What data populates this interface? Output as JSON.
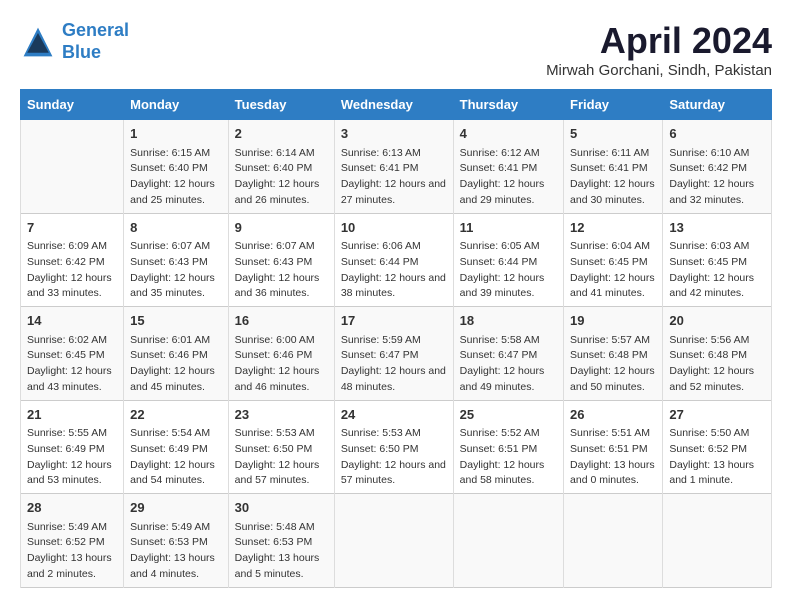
{
  "logo": {
    "line1": "General",
    "line2": "Blue"
  },
  "title": "April 2024",
  "subtitle": "Mirwah Gorchani, Sindh, Pakistan",
  "days_of_week": [
    "Sunday",
    "Monday",
    "Tuesday",
    "Wednesday",
    "Thursday",
    "Friday",
    "Saturday"
  ],
  "weeks": [
    [
      {
        "day": "",
        "info": ""
      },
      {
        "day": "1",
        "info": "Sunrise: 6:15 AM\nSunset: 6:40 PM\nDaylight: 12 hours and 25 minutes."
      },
      {
        "day": "2",
        "info": "Sunrise: 6:14 AM\nSunset: 6:40 PM\nDaylight: 12 hours and 26 minutes."
      },
      {
        "day": "3",
        "info": "Sunrise: 6:13 AM\nSunset: 6:41 PM\nDaylight: 12 hours and 27 minutes."
      },
      {
        "day": "4",
        "info": "Sunrise: 6:12 AM\nSunset: 6:41 PM\nDaylight: 12 hours and 29 minutes."
      },
      {
        "day": "5",
        "info": "Sunrise: 6:11 AM\nSunset: 6:41 PM\nDaylight: 12 hours and 30 minutes."
      },
      {
        "day": "6",
        "info": "Sunrise: 6:10 AM\nSunset: 6:42 PM\nDaylight: 12 hours and 32 minutes."
      }
    ],
    [
      {
        "day": "7",
        "info": "Sunrise: 6:09 AM\nSunset: 6:42 PM\nDaylight: 12 hours and 33 minutes."
      },
      {
        "day": "8",
        "info": "Sunrise: 6:07 AM\nSunset: 6:43 PM\nDaylight: 12 hours and 35 minutes."
      },
      {
        "day": "9",
        "info": "Sunrise: 6:07 AM\nSunset: 6:43 PM\nDaylight: 12 hours and 36 minutes."
      },
      {
        "day": "10",
        "info": "Sunrise: 6:06 AM\nSunset: 6:44 PM\nDaylight: 12 hours and 38 minutes."
      },
      {
        "day": "11",
        "info": "Sunrise: 6:05 AM\nSunset: 6:44 PM\nDaylight: 12 hours and 39 minutes."
      },
      {
        "day": "12",
        "info": "Sunrise: 6:04 AM\nSunset: 6:45 PM\nDaylight: 12 hours and 41 minutes."
      },
      {
        "day": "13",
        "info": "Sunrise: 6:03 AM\nSunset: 6:45 PM\nDaylight: 12 hours and 42 minutes."
      }
    ],
    [
      {
        "day": "14",
        "info": "Sunrise: 6:02 AM\nSunset: 6:45 PM\nDaylight: 12 hours and 43 minutes."
      },
      {
        "day": "15",
        "info": "Sunrise: 6:01 AM\nSunset: 6:46 PM\nDaylight: 12 hours and 45 minutes."
      },
      {
        "day": "16",
        "info": "Sunrise: 6:00 AM\nSunset: 6:46 PM\nDaylight: 12 hours and 46 minutes."
      },
      {
        "day": "17",
        "info": "Sunrise: 5:59 AM\nSunset: 6:47 PM\nDaylight: 12 hours and 48 minutes."
      },
      {
        "day": "18",
        "info": "Sunrise: 5:58 AM\nSunset: 6:47 PM\nDaylight: 12 hours and 49 minutes."
      },
      {
        "day": "19",
        "info": "Sunrise: 5:57 AM\nSunset: 6:48 PM\nDaylight: 12 hours and 50 minutes."
      },
      {
        "day": "20",
        "info": "Sunrise: 5:56 AM\nSunset: 6:48 PM\nDaylight: 12 hours and 52 minutes."
      }
    ],
    [
      {
        "day": "21",
        "info": "Sunrise: 5:55 AM\nSunset: 6:49 PM\nDaylight: 12 hours and 53 minutes."
      },
      {
        "day": "22",
        "info": "Sunrise: 5:54 AM\nSunset: 6:49 PM\nDaylight: 12 hours and 54 minutes."
      },
      {
        "day": "23",
        "info": "Sunrise: 5:53 AM\nSunset: 6:50 PM\nDaylight: 12 hours and 57 minutes."
      },
      {
        "day": "24",
        "info": "Sunrise: 5:53 AM\nSunset: 6:50 PM\nDaylight: 12 hours and 57 minutes."
      },
      {
        "day": "25",
        "info": "Sunrise: 5:52 AM\nSunset: 6:51 PM\nDaylight: 12 hours and 58 minutes."
      },
      {
        "day": "26",
        "info": "Sunrise: 5:51 AM\nSunset: 6:51 PM\nDaylight: 13 hours and 0 minutes."
      },
      {
        "day": "27",
        "info": "Sunrise: 5:50 AM\nSunset: 6:52 PM\nDaylight: 13 hours and 1 minute."
      }
    ],
    [
      {
        "day": "28",
        "info": "Sunrise: 5:49 AM\nSunset: 6:52 PM\nDaylight: 13 hours and 2 minutes."
      },
      {
        "day": "29",
        "info": "Sunrise: 5:49 AM\nSunset: 6:53 PM\nDaylight: 13 hours and 4 minutes."
      },
      {
        "day": "30",
        "info": "Sunrise: 5:48 AM\nSunset: 6:53 PM\nDaylight: 13 hours and 5 minutes."
      },
      {
        "day": "",
        "info": ""
      },
      {
        "day": "",
        "info": ""
      },
      {
        "day": "",
        "info": ""
      },
      {
        "day": "",
        "info": ""
      }
    ]
  ]
}
